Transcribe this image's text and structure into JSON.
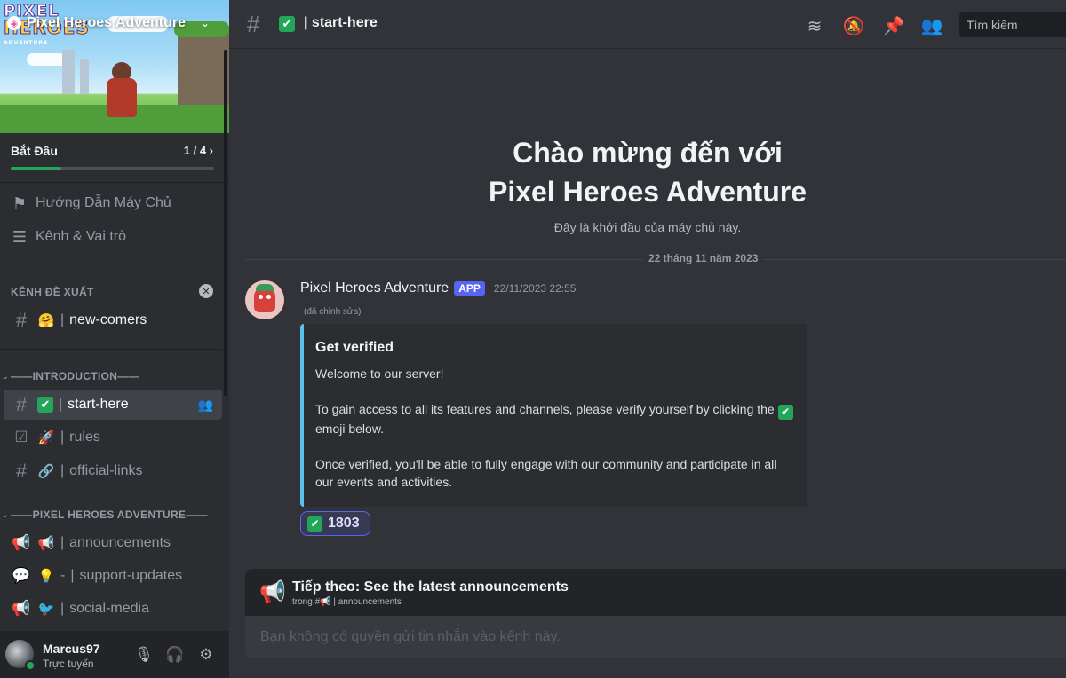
{
  "colors": {
    "accent": "#5865f2",
    "online": "#23a55a",
    "embed_bar": "#5bc0eb",
    "background": "#313338",
    "sidebar": "#2b2d31"
  },
  "server": {
    "name": "Pixel Heroes Adventure",
    "banner_logo": [
      "PIXEL",
      "HEROES",
      "ADVENTURE"
    ]
  },
  "onboarding": {
    "title": "Bắt Đầu",
    "progress_text": "1 / 4",
    "progress_fraction": 0.25
  },
  "sidebar": {
    "guide_items": [
      {
        "label": "Hướng Dẫn Máy Chủ",
        "icon": "signpost-icon"
      },
      {
        "label": "Kênh & Vai trò",
        "icon": "channel-list-icon"
      }
    ],
    "suggested": {
      "header": "KÊNH ĐỀ XUẤT",
      "channel": {
        "emoji": "🤗",
        "name": "new-comers"
      }
    },
    "categories": [
      {
        "label": "——INTRODUCTION——",
        "channels": [
          {
            "emoji": "✅",
            "name": "start-here",
            "active": true
          },
          {
            "emoji": "🚀",
            "name": "rules"
          },
          {
            "emoji": "🔗",
            "name": "official-links"
          }
        ]
      },
      {
        "label": "——PIXEL HEROES ADVENTURE——",
        "channels": [
          {
            "emoji": "📢",
            "name": "announcements"
          },
          {
            "emoji": "💡",
            "name": "support-updates",
            "extra": "-"
          },
          {
            "emoji": "🐦",
            "name": "social-media"
          }
        ]
      }
    ]
  },
  "user": {
    "name": "Marcus97",
    "status": "Trực tuyến"
  },
  "topbar": {
    "channel_name": "start-here",
    "channel_emoji": "✅",
    "search_placeholder": "Tìm kiếm"
  },
  "welcome": {
    "line1": "Chào mừng đến với",
    "line2": "Pixel Heroes Adventure",
    "subtitle": "Đây là khởi đầu của máy chủ này."
  },
  "date_divider": "22 tháng 11 năm 2023",
  "message": {
    "author": "Pixel Heroes Adventure",
    "badge": "APP",
    "timestamp": "22/11/2023 22:55",
    "edited": "(đã chỉnh sửa)",
    "embed": {
      "title": "Get verified",
      "p1": "Welcome to our server!",
      "p2_before": "To gain access to all its features and channels, please verify yourself by clicking the ",
      "p2_emoji": "✔",
      "p2_after": " emoji below.",
      "p3": "Once verified, you'll be able to fully engage with our community and participate in all our events and activities."
    },
    "reaction": {
      "emoji": "✔",
      "count": "1803"
    }
  },
  "next_channel": {
    "title": "Tiếp theo: See the latest announcements",
    "sub_prefix": "trong #📢",
    "sub_channel": "announcements"
  },
  "composer": {
    "placeholder": "Bạn không có quyền gửi tin nhắn vào kênh này."
  }
}
